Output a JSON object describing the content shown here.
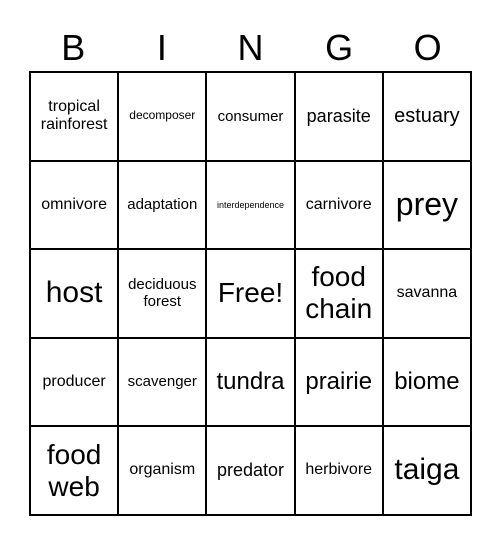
{
  "header": [
    "B",
    "I",
    "N",
    "G",
    "O"
  ],
  "cells": [
    "tropical rainforest",
    "decomposer",
    "consumer",
    "parasite",
    "estuary",
    "omnivore",
    "adaptation",
    "interdependence",
    "carnivore",
    "prey",
    "host",
    "deciduous forest",
    "Free!",
    "food chain",
    "savanna",
    "producer",
    "scavenger",
    "tundra",
    "prairie",
    "biome",
    "food web",
    "organism",
    "predator",
    "herbivore",
    "taiga"
  ]
}
